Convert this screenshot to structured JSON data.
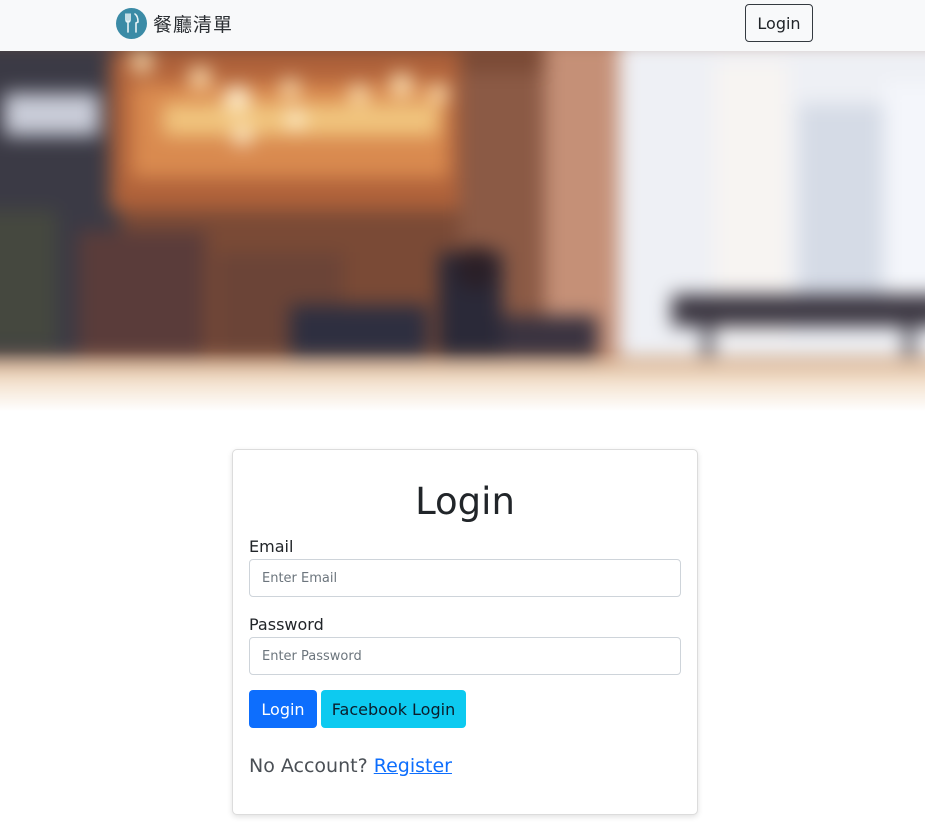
{
  "brand": {
    "name": "餐廳清單",
    "icon": "fork-knife-icon",
    "color": "#3b8ba6"
  },
  "nav": {
    "login_label": "Login"
  },
  "login_card": {
    "title": "Login",
    "email": {
      "label": "Email",
      "placeholder": "Enter Email",
      "value": ""
    },
    "password": {
      "label": "Password",
      "placeholder": "Enter Password",
      "value": ""
    },
    "login_button": "Login",
    "facebook_button": "Facebook Login",
    "no_account_text": "No Account?",
    "register_link": "Register"
  },
  "colors": {
    "primary": "#0d6efd",
    "info": "#0dcaf0",
    "navbar_bg": "#f8f9fa"
  }
}
